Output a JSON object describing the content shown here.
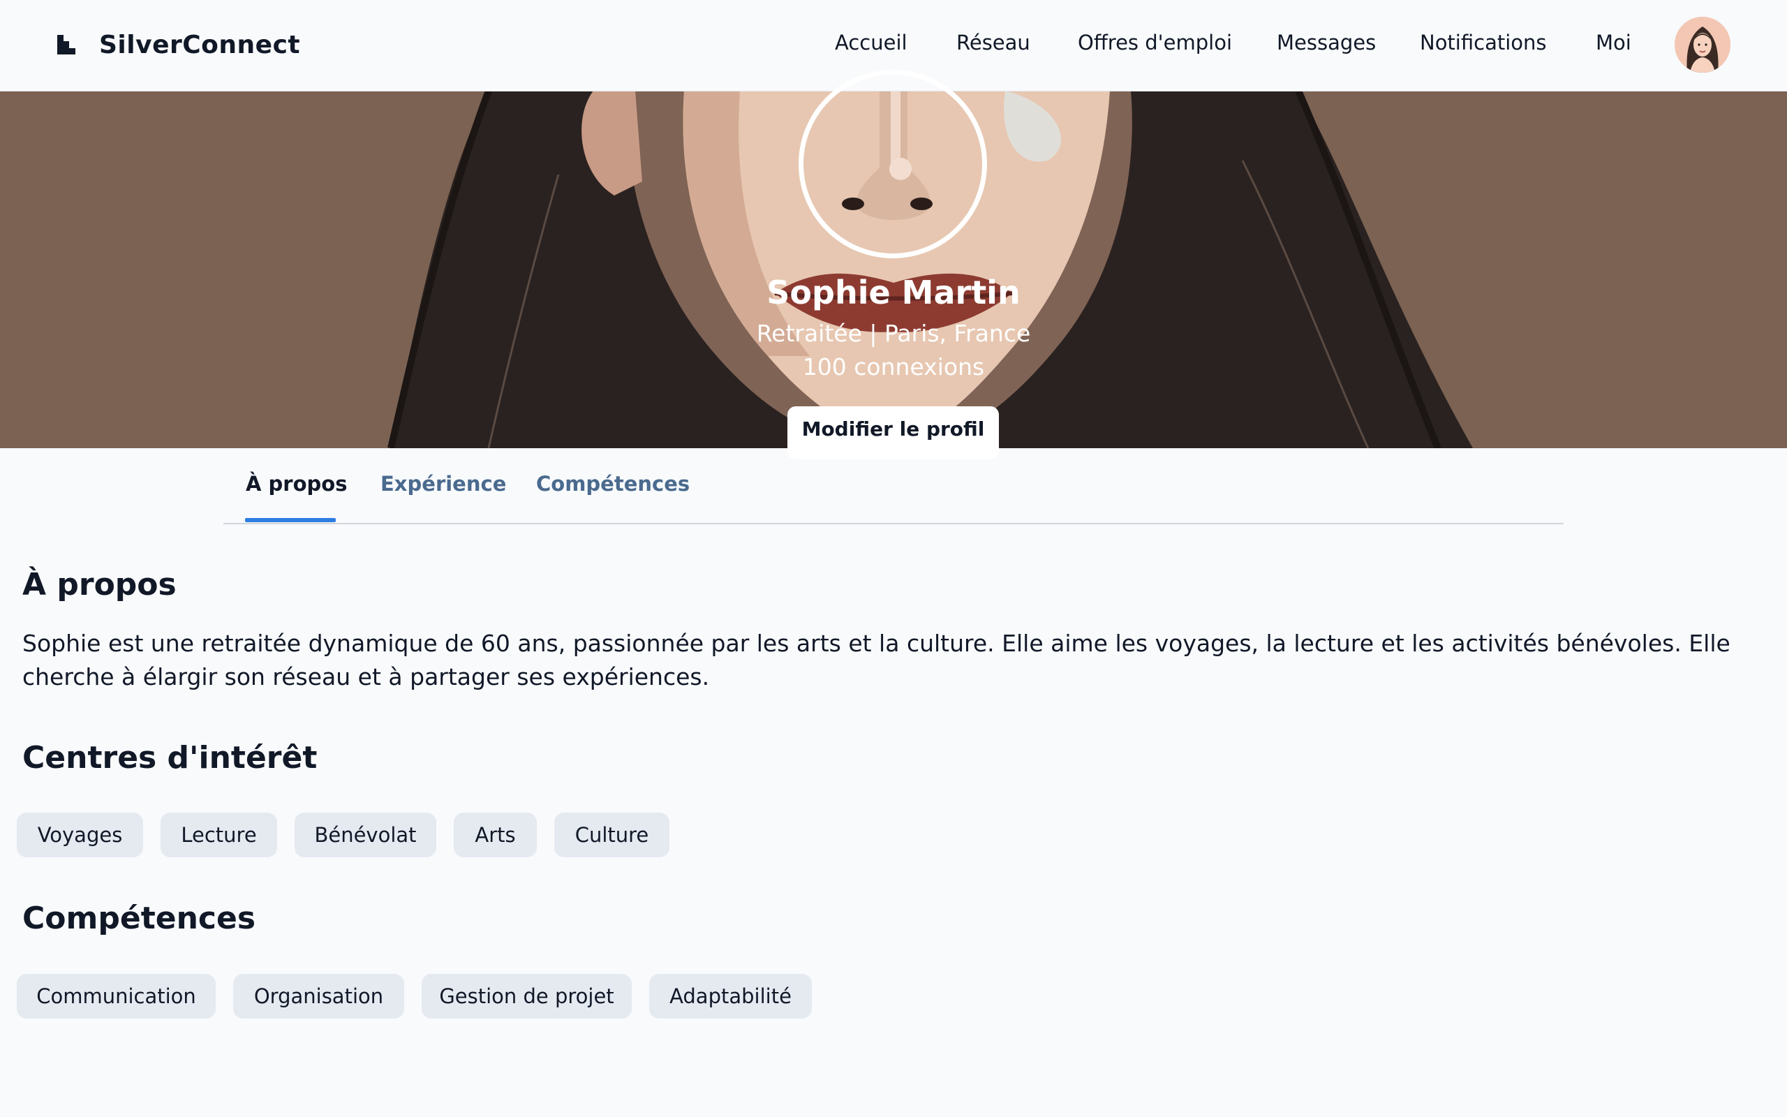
{
  "header": {
    "brand": "SilverConnect",
    "nav": [
      "Accueil",
      "Réseau",
      "Offres d'emploi",
      "Messages",
      "Notifications",
      "Moi"
    ]
  },
  "profile": {
    "name": "Sophie Martin",
    "subtitle": "Retraitée | Paris, France",
    "connections": "100 connexions",
    "edit_label": "Modifier le profil"
  },
  "tabs": [
    "À propos",
    "Expérience",
    "Compétences"
  ],
  "about": {
    "heading": "À propos",
    "text": "Sophie est une retraitée dynamique de 60 ans, passionnée par les arts et la culture. Elle aime les voyages, la lecture et les activités bénévoles. Elle cherche à élargir son réseau et à partager ses expériences."
  },
  "interests": {
    "heading": "Centres d'intérêt",
    "items": [
      "Voyages",
      "Lecture",
      "Bénévolat",
      "Arts",
      "Culture"
    ]
  },
  "skills": {
    "heading": "Compétences",
    "items": [
      "Communication",
      "Organisation",
      "Gestion de projet",
      "Adaptabilité"
    ]
  },
  "colors": {
    "accent": "#2f7de1",
    "tab_inactive": "#4a6a8e",
    "chip_bg": "#e5eaf1"
  },
  "icons": [
    "brand-logo-icon",
    "user-avatar-icon"
  ]
}
